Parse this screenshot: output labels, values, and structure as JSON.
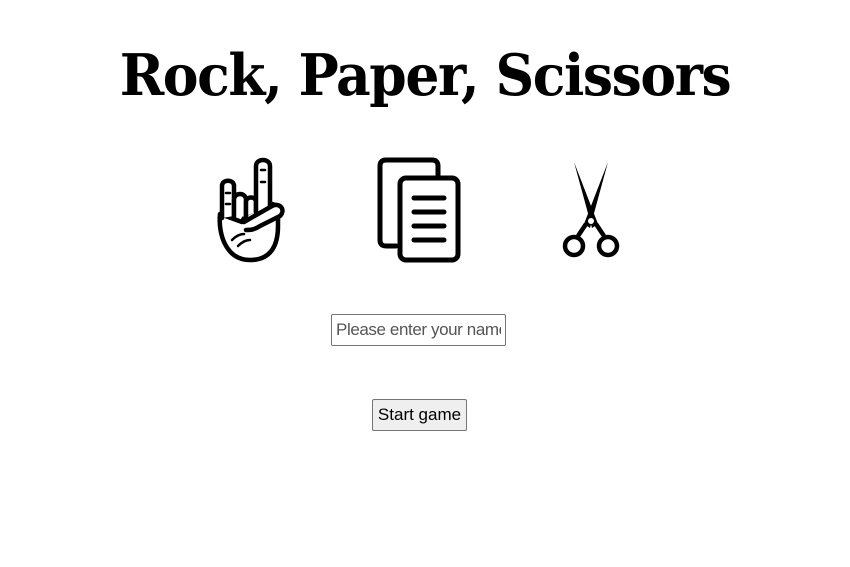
{
  "title": "Rock, Paper, Scissors",
  "choices": [
    {
      "name": "rock",
      "icon": "rock-hand-icon"
    },
    {
      "name": "paper",
      "icon": "paper-documents-icon"
    },
    {
      "name": "scissors",
      "icon": "scissors-icon"
    }
  ],
  "name_input": {
    "value": "",
    "placeholder": "Please enter your name"
  },
  "start_button": {
    "label": "Start game"
  },
  "colors": {
    "background": "#ffffff",
    "foreground": "#000000",
    "button_bg": "#efefef",
    "border": "#767676"
  }
}
